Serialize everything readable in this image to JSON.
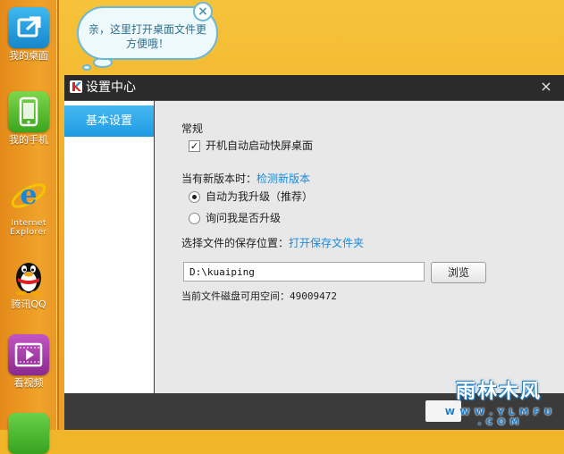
{
  "dock": {
    "items": [
      {
        "label": "我的桌面",
        "icon": "desktop-icon"
      },
      {
        "label": "我的手机",
        "icon": "phone-icon"
      },
      {
        "label": "Internet Explorer",
        "icon": "ie-icon"
      },
      {
        "label": "腾讯QQ",
        "icon": "qq-penguin-icon"
      },
      {
        "label": "看视频",
        "icon": "video-icon"
      }
    ]
  },
  "bubble": {
    "text": "亲，这里打开桌面文件更方便哦！",
    "close": "×"
  },
  "window": {
    "title": "设置中心",
    "close": "×",
    "sidebar": {
      "active_item": "基本设置"
    },
    "general": {
      "heading": "常规",
      "autostart_label": "开机自动启动快屏桌面",
      "autostart_checked": true,
      "checkmark": "✓"
    },
    "update": {
      "prompt": "当有新版本时：",
      "check_link": "检测新版本",
      "options": [
        {
          "label": "自动为我升级（推荐）",
          "selected": true
        },
        {
          "label": "询问我是否升级",
          "selected": false
        }
      ]
    },
    "storage": {
      "prompt": "选择文件的保存位置：",
      "open_folder_link": "打开保存文件夹",
      "path": "D:\\kuaiping",
      "browse_label": "浏览",
      "free_space_label": "当前文件磁盘可用空间：",
      "free_space_value": "49009472"
    }
  },
  "watermark": {
    "brand": "雨林木风",
    "url": "W W W . Y L M F U . C O M"
  },
  "colors": {
    "desktop_bg": "#f1b52a",
    "dock_bg": "#f0a32a",
    "title_bar": "#2b2b2b",
    "accent_blue": "#1f9be3",
    "link": "#1a8bd8",
    "content_bg": "#e8e8e8"
  }
}
